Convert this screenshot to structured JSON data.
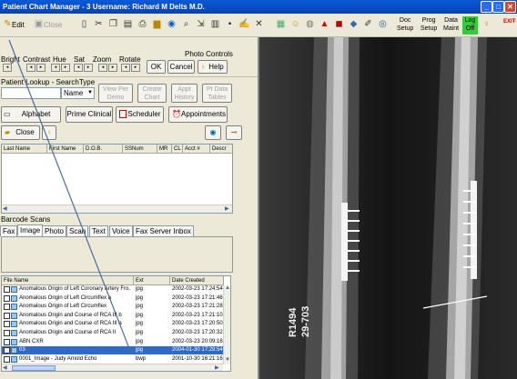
{
  "window": {
    "title": "Patient Chart Manager - 3  Username: Richard M Delts M.D."
  },
  "toolbar": {
    "edit_label": "Edit",
    "close_label": "Close",
    "doc_setup": [
      "Doc",
      "Setup"
    ],
    "prog_setup": [
      "Prog",
      "Setup"
    ],
    "data_maint": [
      "Data",
      "Maint"
    ],
    "log_off": [
      "Log",
      "Off"
    ],
    "exit_label": "EXIT"
  },
  "photo_controls": {
    "title": "Photo Controls",
    "bright": "Bright",
    "contrast": "Contrast",
    "hue": "Hue",
    "sat": "Sat",
    "zoom": "Zoom",
    "rotate": "Rotate",
    "ok": "OK",
    "cancel": "Cancel",
    "help": "Help"
  },
  "lookup": {
    "label": "Patient Lookup - SearchType",
    "search_type": "Name",
    "view_per_demo": [
      "View Per",
      "Demo"
    ],
    "create_chart": [
      "Create",
      "Chart"
    ],
    "appt_history": [
      "Appt",
      "History"
    ],
    "pt_data_tables": [
      "Pt Data",
      "Tables"
    ]
  },
  "nav": {
    "alphabet": "Alphabet",
    "prime_clinical": "Prime Clinical",
    "scheduler": "Scheduler",
    "appointments": "Appointments",
    "close": "Close"
  },
  "patient_table": {
    "columns": [
      "Last Name",
      "First Name",
      "D.O.B.",
      "SSNum",
      "MR",
      "CL",
      "Acct #",
      "Descr"
    ]
  },
  "barcode": {
    "label": "Barcode Scans",
    "tabs": [
      "Fax",
      "Image",
      "Photo",
      "Scan",
      "Text",
      "Voice",
      "Fax Server Inbox"
    ],
    "active_tab": "Image"
  },
  "files": {
    "columns": [
      "File Name",
      "Ext",
      "Date Created"
    ],
    "rows": [
      {
        "name": "Anomalous Origin of Left Coronary Artery Fro...",
        "ext": "jpg",
        "date": "2002-03-23 17:24:54"
      },
      {
        "name": "Anomalous Origin of Left Circumflex a",
        "ext": "jpg",
        "date": "2002-03-23 17:21:46"
      },
      {
        "name": "Anomalous Origin of Left Circumflex",
        "ext": "jpg",
        "date": "2002-03-23 17:21:28"
      },
      {
        "name": "Anomalous Origin and Course of RCA III b",
        "ext": "jpg",
        "date": "2002-03-23 17:21:10"
      },
      {
        "name": "Anomalous Origin and Course of RCA III a",
        "ext": "jpg",
        "date": "2002-03-23 17:20:50"
      },
      {
        "name": "Anomalous Origin and Course of RCA II",
        "ext": "jpg",
        "date": "2002-03-23 17:20:32"
      },
      {
        "name": "ABN CXR",
        "ext": "jpg",
        "date": "2002-03-23 20:09:16"
      },
      {
        "name": "03",
        "ext": "jpg",
        "date": "2004-01-30 17:29:54"
      },
      {
        "name": "0001_Image - Judy Arnold Echo",
        "ext": "bwp",
        "date": "2001-10-30 16:21:16"
      }
    ],
    "selected_index": 7
  },
  "xray": {
    "marker_text": [
      "R1494",
      "29-703"
    ]
  }
}
